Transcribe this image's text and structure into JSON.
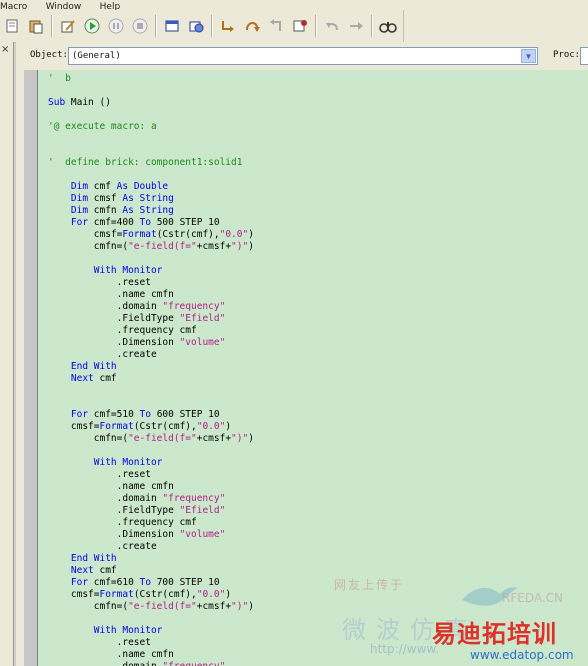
{
  "menu": {
    "items": [
      "Macro",
      "Window",
      "Help"
    ]
  },
  "toolbar": {
    "icons": [
      "cut-icon",
      "paste-icon",
      "edit-icon",
      "run-icon",
      "pause-icon",
      "stop-icon",
      "dialog-icon",
      "open-dialog-icon",
      "step-into-icon",
      "step-over-icon",
      "step-out-icon",
      "breakpoint-icon",
      "undo-icon",
      "redo-icon",
      "find-icon"
    ]
  },
  "editor": {
    "object_label": "Object:",
    "object_value": "(General)",
    "proc_label": "Proc:",
    "close_label": "×"
  },
  "code": {
    "lines": [
      [
        {
          "t": "'  b",
          "c": "cm"
        }
      ],
      [],
      [
        {
          "t": "Sub ",
          "c": "kw"
        },
        {
          "t": "Main ()",
          "c": ""
        }
      ],
      [],
      [
        {
          "t": "'@ execute macro: a",
          "c": "cm"
        }
      ],
      [],
      [],
      [
        {
          "t": "'  define brick: component1:solid1",
          "c": "cm"
        }
      ],
      [],
      [
        {
          "t": "    Dim ",
          "c": "kw"
        },
        {
          "t": "cmf ",
          "c": ""
        },
        {
          "t": "As Double",
          "c": "kw"
        }
      ],
      [
        {
          "t": "    Dim ",
          "c": "kw"
        },
        {
          "t": "cmsf ",
          "c": ""
        },
        {
          "t": "As String",
          "c": "kw"
        }
      ],
      [
        {
          "t": "    Dim ",
          "c": "kw"
        },
        {
          "t": "cmfn ",
          "c": ""
        },
        {
          "t": "As String",
          "c": "kw"
        }
      ],
      [
        {
          "t": "    For ",
          "c": "kw"
        },
        {
          "t": "cmf=400 ",
          "c": ""
        },
        {
          "t": "To ",
          "c": "kw"
        },
        {
          "t": "500 STEP 10",
          "c": ""
        }
      ],
      [
        {
          "t": "        cmsf=",
          "c": ""
        },
        {
          "t": "Format",
          "c": "fn"
        },
        {
          "t": "(Cstr(cmf),",
          "c": ""
        },
        {
          "t": "\"0.0\"",
          "c": "st"
        },
        {
          "t": ")",
          "c": ""
        }
      ],
      [
        {
          "t": "        cmfn=(",
          "c": ""
        },
        {
          "t": "\"e-field(f=\"",
          "c": "st"
        },
        {
          "t": "+cmsf+",
          "c": ""
        },
        {
          "t": "\")\"",
          "c": "st"
        },
        {
          "t": ")",
          "c": ""
        }
      ],
      [],
      [
        {
          "t": "        With Monitor",
          "c": "kw"
        }
      ],
      [
        {
          "t": "            .reset",
          "c": ""
        }
      ],
      [
        {
          "t": "            .name cmfn",
          "c": ""
        }
      ],
      [
        {
          "t": "            .domain ",
          "c": ""
        },
        {
          "t": "\"frequency\"",
          "c": "st"
        }
      ],
      [
        {
          "t": "            .FieldType ",
          "c": ""
        },
        {
          "t": "\"Efield\"",
          "c": "st"
        }
      ],
      [
        {
          "t": "            .frequency cmf",
          "c": ""
        }
      ],
      [
        {
          "t": "            .Dimension ",
          "c": ""
        },
        {
          "t": "\"volume\"",
          "c": "st"
        }
      ],
      [
        {
          "t": "            .create",
          "c": ""
        }
      ],
      [
        {
          "t": "    End With",
          "c": "kw"
        }
      ],
      [
        {
          "t": "    Next ",
          "c": "kw"
        },
        {
          "t": "cmf",
          "c": ""
        }
      ],
      [],
      [],
      [
        {
          "t": "    For ",
          "c": "kw"
        },
        {
          "t": "cmf=510 ",
          "c": ""
        },
        {
          "t": "To ",
          "c": "kw"
        },
        {
          "t": "600 STEP 10",
          "c": ""
        }
      ],
      [
        {
          "t": "    cmsf=",
          "c": ""
        },
        {
          "t": "Format",
          "c": "fn"
        },
        {
          "t": "(Cstr(cmf),",
          "c": ""
        },
        {
          "t": "\"0.0\"",
          "c": "st"
        },
        {
          "t": ")",
          "c": ""
        }
      ],
      [
        {
          "t": "        cmfn=(",
          "c": ""
        },
        {
          "t": "\"e-field(f=\"",
          "c": "st"
        },
        {
          "t": "+cmsf+",
          "c": ""
        },
        {
          "t": "\")\"",
          "c": "st"
        },
        {
          "t": ")",
          "c": ""
        }
      ],
      [],
      [
        {
          "t": "        With Monitor",
          "c": "kw"
        }
      ],
      [
        {
          "t": "            .reset",
          "c": ""
        }
      ],
      [
        {
          "t": "            .name cmfn",
          "c": ""
        }
      ],
      [
        {
          "t": "            .domain ",
          "c": ""
        },
        {
          "t": "\"frequency\"",
          "c": "st"
        }
      ],
      [
        {
          "t": "            .FieldType ",
          "c": ""
        },
        {
          "t": "\"Efield\"",
          "c": "st"
        }
      ],
      [
        {
          "t": "            .frequency cmf",
          "c": ""
        }
      ],
      [
        {
          "t": "            .Dimension ",
          "c": ""
        },
        {
          "t": "\"volume\"",
          "c": "st"
        }
      ],
      [
        {
          "t": "            .create",
          "c": ""
        }
      ],
      [
        {
          "t": "    End With",
          "c": "kw"
        }
      ],
      [
        {
          "t": "    Next ",
          "c": "kw"
        },
        {
          "t": "cmf",
          "c": ""
        }
      ],
      [
        {
          "t": "    For ",
          "c": "kw"
        },
        {
          "t": "cmf=610 ",
          "c": ""
        },
        {
          "t": "To ",
          "c": "kw"
        },
        {
          "t": "700 STEP 10",
          "c": ""
        }
      ],
      [
        {
          "t": "    cmsf=",
          "c": ""
        },
        {
          "t": "Format",
          "c": "fn"
        },
        {
          "t": "(Cstr(cmf),",
          "c": ""
        },
        {
          "t": "\"0.0\"",
          "c": "st"
        },
        {
          "t": ")",
          "c": ""
        }
      ],
      [
        {
          "t": "        cmfn=(",
          "c": ""
        },
        {
          "t": "\"e-field(f=\"",
          "c": "st"
        },
        {
          "t": "+cmsf+",
          "c": ""
        },
        {
          "t": "\")\"",
          "c": "st"
        },
        {
          "t": ")",
          "c": ""
        }
      ],
      [],
      [
        {
          "t": "        With Monitor",
          "c": "kw"
        }
      ],
      [
        {
          "t": "            .reset",
          "c": ""
        }
      ],
      [
        {
          "t": "            .name cmfn",
          "c": ""
        }
      ],
      [
        {
          "t": "            .domain ",
          "c": ""
        },
        {
          "t": "\"frequency\"",
          "c": "st"
        }
      ]
    ]
  },
  "watermark": {
    "line1": "网友上传于",
    "rfeda": "RFEDA.CN",
    "line2": "微波仿真",
    "url": "http://www.",
    "brand": "易迪拓培训",
    "brand_url": "www.edatop.com"
  }
}
